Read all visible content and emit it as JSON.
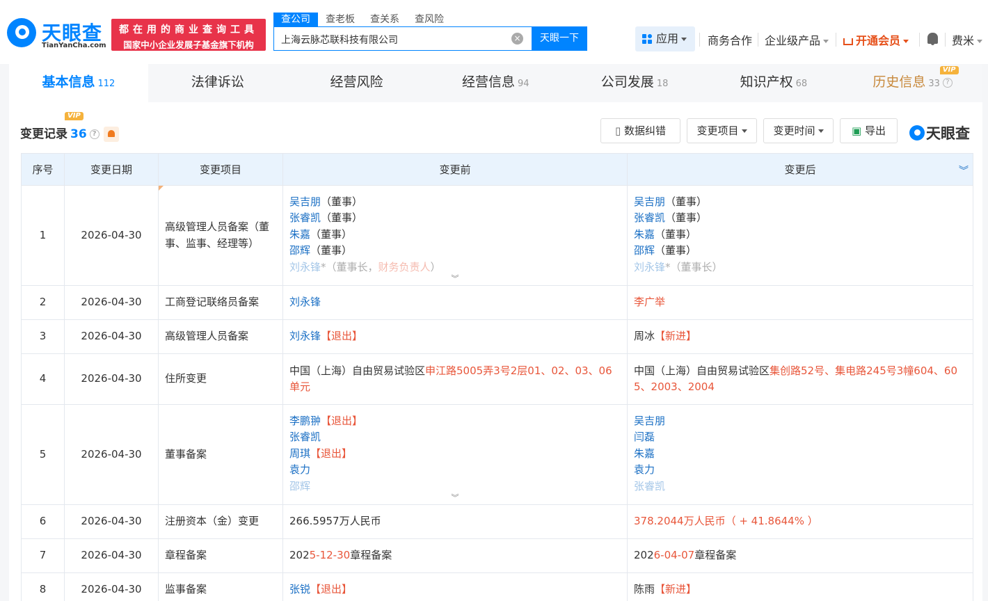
{
  "header": {
    "logo_text": "天眼查",
    "logo_domain": "TianYanCha.com",
    "slogan_line1": "都在用的商业查询工具",
    "slogan_line2": "国家中小企业发展子基金旗下机构",
    "search_tabs": [
      "查公司",
      "查老板",
      "查关系",
      "查风险"
    ],
    "search_value": "上海云脉芯联科技有限公司",
    "search_button": "天眼一下",
    "apps_label": "应用",
    "nav_business": "商务合作",
    "nav_enterprise": "企业级产品",
    "nav_vip": "开通会员",
    "user_name": "费米"
  },
  "tabs": [
    {
      "label": "基本信息",
      "count": "112"
    },
    {
      "label": "法律诉讼",
      "count": ""
    },
    {
      "label": "经营风险",
      "count": ""
    },
    {
      "label": "经营信息",
      "count": "94"
    },
    {
      "label": "公司发展",
      "count": "18"
    },
    {
      "label": "知识产权",
      "count": "68"
    },
    {
      "label": "历史信息",
      "count": "33"
    }
  ],
  "vip_tag": "VIP",
  "section": {
    "title": "变更记录",
    "count": "36",
    "btn_correct": "数据纠错",
    "btn_item": "变更项目",
    "btn_time": "变更时间",
    "btn_export": "导出",
    "brand": "天眼查"
  },
  "table": {
    "headers": [
      "序号",
      "变更日期",
      "变更项目",
      "变更前",
      "变更后"
    ],
    "rows": [
      {
        "no": "1",
        "date": "2026-04-30",
        "item": "高级管理人员备案（董事、监事、经理等）"
      },
      {
        "no": "2",
        "date": "2026-04-30",
        "item": "工商登记联络员备案"
      },
      {
        "no": "3",
        "date": "2026-04-30",
        "item": "高级管理人员备案"
      },
      {
        "no": "4",
        "date": "2026-04-30",
        "item": "住所变更"
      },
      {
        "no": "5",
        "date": "2026-04-30",
        "item": "董事备案"
      },
      {
        "no": "6",
        "date": "2026-04-30",
        "item": "注册资本（金）变更"
      },
      {
        "no": "7",
        "date": "2026-04-30",
        "item": "章程备案"
      },
      {
        "no": "8",
        "date": "2026-04-30",
        "item": "监事备案"
      }
    ],
    "r1_before": [
      "吴吉朋",
      "张睿凯",
      "朱嘉",
      "邵辉",
      "刘永锋"
    ],
    "r1_after": [
      "吴吉朋",
      "张睿凯",
      "朱嘉",
      "邵辉",
      "刘永锋"
    ],
    "role_director": "（董事）",
    "role_chair_cfo_a": "（董事长，",
    "role_chair_cfo_b": "财务负责人",
    "role_chair_cfo_c": "）",
    "role_chair": "（董事长）",
    "star": "*",
    "r2_before": "刘永锋",
    "r2_after": "李广举",
    "r3_before_name": "刘永锋",
    "r3_after_name": "周冰",
    "tag_exit": "【退出】",
    "tag_new": "【新进】",
    "r4_before_a": "中国（上海）自由贸易试验区",
    "r4_before_b": "申江路5005弄3号2层01、02、03、06",
    "r4_before_c": "单元",
    "r4_after_a": "中国（上海）自由贸易试验区",
    "r4_after_b": "集创路52号、集电路245号3幢604、60",
    "r4_after_c": "5、2003、2004",
    "r5_before": [
      "李鹏翀",
      "张睿凯",
      "周琪",
      "袁力",
      "邵辉"
    ],
    "r5_after": [
      "吴吉朋",
      "闫磊",
      "朱嘉",
      "袁力",
      "张睿凯"
    ],
    "r6_before": "266.5957万人民币",
    "r6_after_a": "378.2044万人民币",
    "r6_after_b": "（ + 41.8644% ）",
    "r7_before_a": "202",
    "r7_before_b": "5-12-30",
    "r7_before_c": "章程备案",
    "r7_after_a": "202",
    "r7_after_b": "6-04-07",
    "r7_after_c": "章程备案",
    "r8_before": "张锐",
    "r8_after": "陈雨"
  },
  "colors": {
    "accent": "#0084ff",
    "link": "#1a6fc4",
    "red": "#e8563a",
    "slogan": "#e8334a",
    "vip": "#f5b23c"
  }
}
